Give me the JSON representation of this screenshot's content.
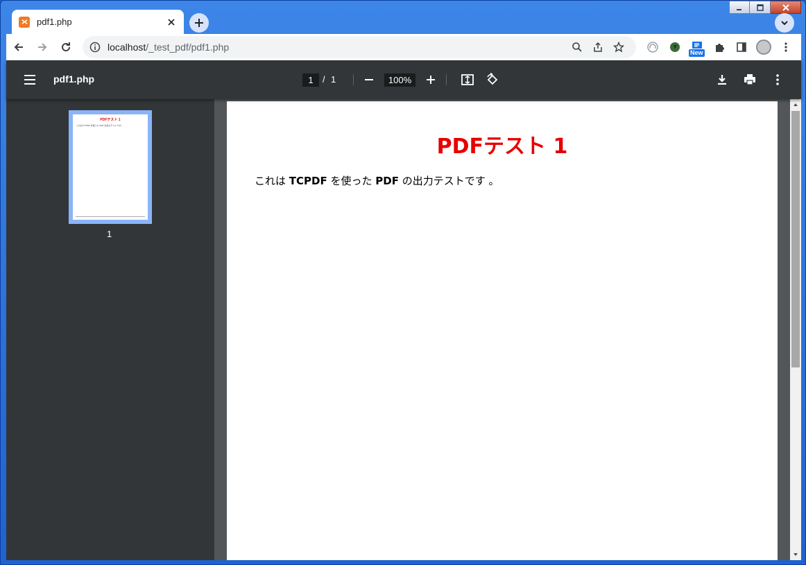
{
  "browser": {
    "tab_title": "pdf1.php",
    "url_host": "localhost",
    "url_path": "/_test_pdf/pdf1.php",
    "new_badge": "New"
  },
  "pdf_viewer": {
    "title": "pdf1.php",
    "current_page": "1",
    "separator": "/",
    "total_pages": "1",
    "zoom": "100%",
    "thumbnail_label": "1"
  },
  "document": {
    "heading": "PDFテスト 1",
    "body_parts": [
      "これは ",
      "TCPDF",
      " を使った ",
      "PDF",
      " の出力テストです 。"
    ],
    "thumb_heading": "PDFテスト 1",
    "thumb_body": "これは TCPDF を使った PDF の出力テストです 。"
  },
  "colors": {
    "heading_red": "#e60000",
    "toolbar_dark": "#323639",
    "viewer_bg": "#525659",
    "thumb_border": "#8ab4f8"
  }
}
